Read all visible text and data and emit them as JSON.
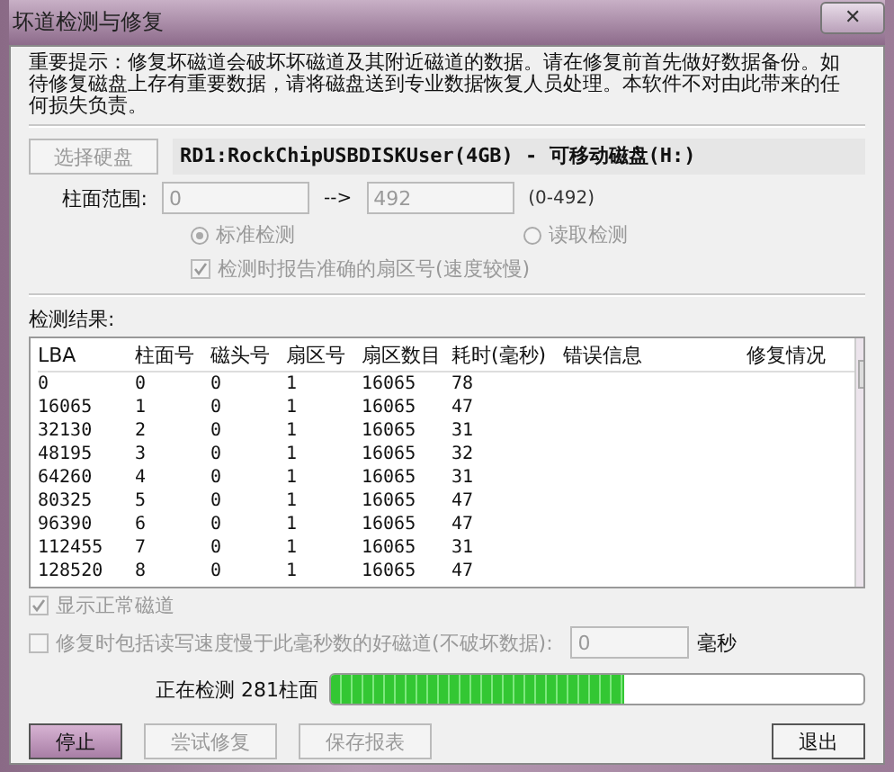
{
  "window": {
    "title": "坏道检测与修复",
    "close": "✕"
  },
  "notice": "重要提示：修复坏磁道会破坏坏磁道及其附近磁道的数据。请在修复前首先做好数据备份。如待修复磁盘上存有重要数据，请将磁盘送到专业数据恢复人员处理。本软件不对由此带来的任何损失负责。",
  "disk": {
    "button": "选择硬盘",
    "disabled": true,
    "name": "RD1:RockChipUSBDISKUser(4GB) - 可移动磁盘(H:)"
  },
  "range": {
    "label": "柱面范围:",
    "from": "0",
    "arrow": "-->",
    "to": "492",
    "hint": "(0-492)"
  },
  "modes": [
    {
      "label": "标准检测",
      "selected": true
    },
    {
      "label": "读取检测",
      "selected": false
    }
  ],
  "report_sector": {
    "label": "检测时报告准确的扇区号(速度较慢)",
    "checked": true
  },
  "results_label": "检测结果:",
  "table": {
    "columns": [
      "LBA",
      "柱面号",
      "磁头号",
      "扇区号",
      "扇区数目",
      "耗时(毫秒)",
      "错误信息",
      "修复情况"
    ],
    "rows": [
      [
        "0",
        "0",
        "0",
        "1",
        "16065",
        "78"
      ],
      [
        "16065",
        "1",
        "0",
        "1",
        "16065",
        "47"
      ],
      [
        "32130",
        "2",
        "0",
        "1",
        "16065",
        "31"
      ],
      [
        "48195",
        "3",
        "0",
        "1",
        "16065",
        "32"
      ],
      [
        "64260",
        "4",
        "0",
        "1",
        "16065",
        "31"
      ],
      [
        "80325",
        "5",
        "0",
        "1",
        "16065",
        "47"
      ],
      [
        "96390",
        "6",
        "0",
        "1",
        "16065",
        "47"
      ],
      [
        "112455",
        "7",
        "0",
        "1",
        "16065",
        "31"
      ],
      [
        "128520",
        "8",
        "0",
        "1",
        "16065",
        "47"
      ]
    ]
  },
  "show_normal": {
    "label": "显示正常磁道",
    "checked": true
  },
  "repair_slow": {
    "label": "修复时包括读写速度慢于此毫秒数的好磁道(不破坏数据):",
    "checked": false,
    "value": "0",
    "unit": "毫秒"
  },
  "progress": {
    "label": "正在检测 281柱面",
    "level": 0.55
  },
  "buttons": [
    {
      "label": "停止",
      "kind": "primary"
    },
    {
      "label": "尝试修复",
      "kind": "disabled"
    },
    {
      "label": "保存报表",
      "kind": "disabled"
    },
    {
      "label": "退出",
      "kind": "normal"
    }
  ]
}
